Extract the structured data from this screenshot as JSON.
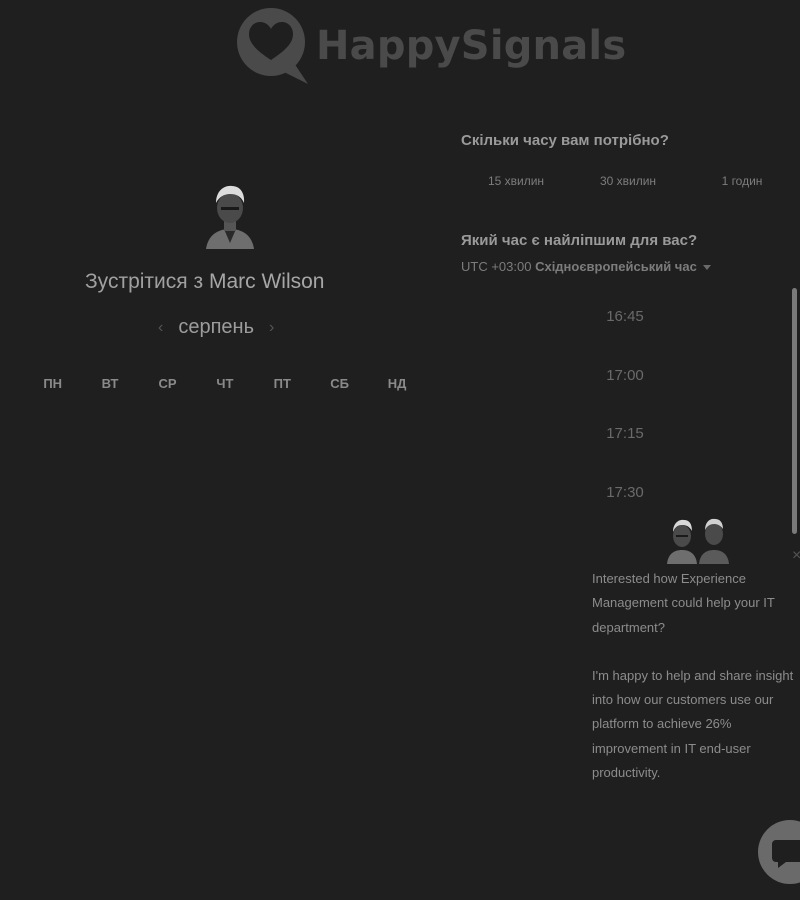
{
  "brand": {
    "name": "HappySignals",
    "logo_icon": "heart-speech-bubble-icon",
    "logo_color": "#4a4a4a"
  },
  "host": {
    "title_prefix": "Зустрітися з",
    "name": "Marc Wilson"
  },
  "calendar": {
    "month": "серпень",
    "weekdays": [
      "ПН",
      "ВТ",
      "СР",
      "ЧТ",
      "ПТ",
      "СБ",
      "НД"
    ],
    "weeks": [
      [
        "",
        "",
        "",
        "",
        "",
        "",
        ""
      ],
      [
        "",
        "",
        "",
        "",
        "",
        "",
        ""
      ],
      [
        "",
        "",
        "",
        "",
        "",
        "",
        ""
      ],
      [
        "",
        "",
        "",
        "",
        "",
        "",
        ""
      ],
      [
        "",
        "",
        "",
        "",
        "",
        "",
        ""
      ]
    ]
  },
  "duration": {
    "question": "Скільки часу вам потрібно?",
    "options": [
      "15 хвилин",
      "30 хвилин",
      "1 годин"
    ]
  },
  "time": {
    "question": "Який час є найліпшим для вас?",
    "tz_offset": "UTC +03:00",
    "tz_name": "Східноєвропейський час",
    "slots": [
      "16:45",
      "17:00",
      "17:15",
      "17:30"
    ]
  },
  "chat": {
    "message_1": "Interested how Experience Management could help your IT department?",
    "message_2": "I'm happy to help and share insight into how our customers use our platform to achieve 26% improvement in IT end-user productivity."
  }
}
